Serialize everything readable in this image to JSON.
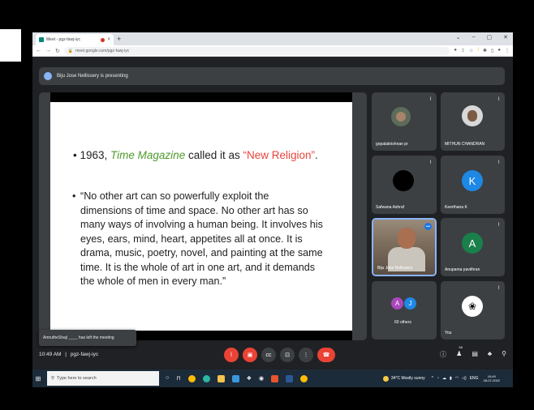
{
  "browser": {
    "tab_title": "Meet - pgz-fawj-iyc",
    "url": "meet.google.com/pgz-fawj-iyc"
  },
  "banner": {
    "presenting_text": "Biju Jose Nellissery is presenting"
  },
  "slide": {
    "line1_prefix": "1963, ",
    "line1_magazine": "Time Magazine",
    "line1_mid": " called it as ",
    "line1_quote": "“New Religion”",
    "line1_end": ".",
    "bullet2_lines": [
      "“No other art can so powerfully exploit the",
      "dimensions of time and space. No other art has so",
      "many ways of involving a human being. It involves his",
      "eyes, ears, mind, heart, appetites all at once. It is",
      "drama, music, poetry, novel, and painting at the same",
      "time. It is the whole of art in one art, and it demands",
      "the whole of men in every man.”"
    ]
  },
  "participants": [
    {
      "name": "gopalakrishnan pr"
    },
    {
      "name": "MITHUN CHANDRAN"
    },
    {
      "name": "Safwana Ashraf"
    },
    {
      "name": "Keerthana K",
      "initial": "K",
      "color": "#1e88e5"
    },
    {
      "name": "Biju Jose Nellissery"
    },
    {
      "name": "Anupama pavithran",
      "initial": "A",
      "color": "#1a7f4b"
    },
    {
      "name": "60 others",
      "initials": [
        "A",
        "J"
      ],
      "colors": [
        "#ab47bc",
        "#1e88e5"
      ]
    },
    {
      "name": "You"
    }
  ],
  "toast": {
    "text": "AmrutheShaji ____ has left the meeting"
  },
  "controls": {
    "time": "10:49 AM",
    "separator": "|",
    "meeting_code": "pgz-fawj-iyc",
    "people_count": "68"
  },
  "taskbar": {
    "search_placeholder": "Type here to search",
    "weather": "34°C  Mostly sunny",
    "lang": "ENG",
    "time": "10:49",
    "date": "28-07-2022"
  }
}
